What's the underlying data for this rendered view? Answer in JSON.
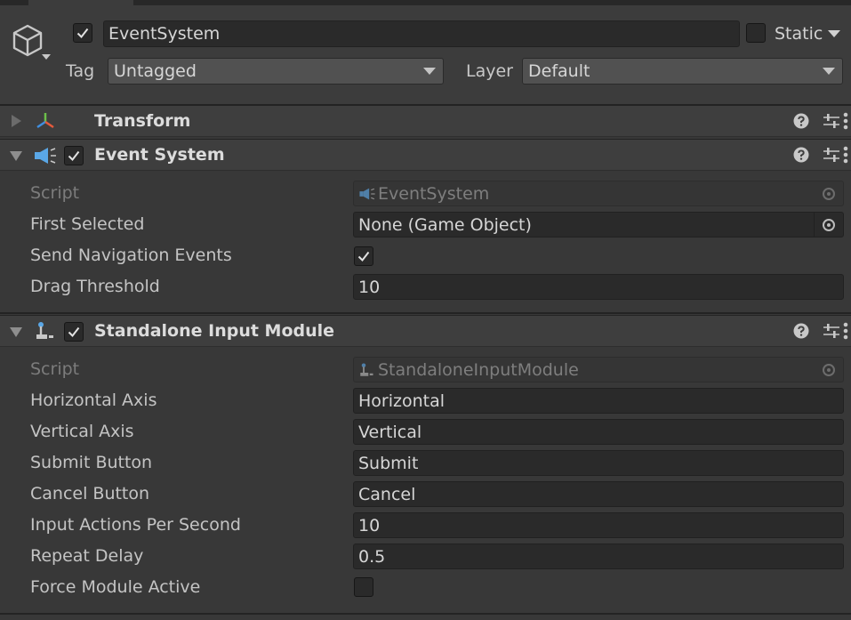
{
  "gameobject": {
    "active": true,
    "name": "EventSystem",
    "static_checked": false,
    "static_label": "Static",
    "tag_label": "Tag",
    "tag_value": "Untagged",
    "layer_label": "Layer",
    "layer_value": "Default",
    "icon": "gameobject-cube-icon"
  },
  "components": {
    "transform": {
      "title": "Transform",
      "expanded": false,
      "icon": "transform-axes-icon"
    },
    "event_system": {
      "title": "Event System",
      "enabled": true,
      "expanded": true,
      "icon": "event-system-megaphone-icon",
      "fields": {
        "script_label": "Script",
        "script_value": "EventSystem",
        "first_selected_label": "First Selected",
        "first_selected_value": "None (Game Object)",
        "send_nav_label": "Send Navigation Events",
        "send_nav_value": true,
        "drag_threshold_label": "Drag Threshold",
        "drag_threshold_value": "10"
      }
    },
    "standalone_input": {
      "title": "Standalone Input Module",
      "enabled": true,
      "expanded": true,
      "icon": "input-module-joystick-icon",
      "fields": {
        "script_label": "Script",
        "script_value": "StandaloneInputModule",
        "horizontal_label": "Horizontal Axis",
        "horizontal_value": "Horizontal",
        "vertical_label": "Vertical Axis",
        "vertical_value": "Vertical",
        "submit_label": "Submit Button",
        "submit_value": "Submit",
        "cancel_label": "Cancel Button",
        "cancel_value": "Cancel",
        "ips_label": "Input Actions Per Second",
        "ips_value": "10",
        "repeat_label": "Repeat Delay",
        "repeat_value": "0.5",
        "force_label": "Force Module Active",
        "force_value": false
      }
    }
  },
  "colors": {
    "background": "#383838",
    "field": "#2a2a2a",
    "dropdown": "#515151",
    "header": "#3e3e3e"
  }
}
